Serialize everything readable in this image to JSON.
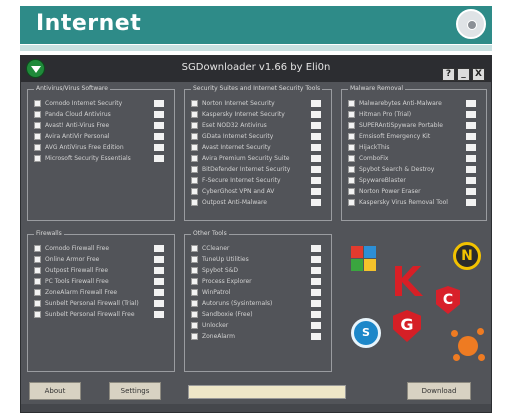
{
  "banner": {
    "title": "Internet",
    "accent": "#2e8b88"
  },
  "window": {
    "title": "SGDownloader v1.66 by Eli0n",
    "controls": [
      "?",
      "_",
      "X"
    ]
  },
  "panels": [
    {
      "title": "Antivirus/Virus Software",
      "items": [
        {
          "label": "Comodo Internet Security",
          "version": ""
        },
        {
          "label": "Panda Cloud Antivirus",
          "version": ""
        },
        {
          "label": "Avast! Anti-Virus Free",
          "version": ""
        },
        {
          "label": "Avira AntiVir Personal",
          "version": ""
        },
        {
          "label": "AVG AntiVirus Free Edition",
          "version": ""
        },
        {
          "label": "Microsoft Security Essentials",
          "version": ""
        }
      ]
    },
    {
      "title": "Security Suites and Internet Security Tools",
      "items": [
        {
          "label": "Norton Internet Security",
          "version": ""
        },
        {
          "label": "Kaspersky Internet Security",
          "version": ""
        },
        {
          "label": "Eset NOD32 Antivirus",
          "version": ""
        },
        {
          "label": "GData Internet Security",
          "version": ""
        },
        {
          "label": "Avast Internet Security",
          "version": ""
        },
        {
          "label": "Avira Premium Security Suite",
          "version": ""
        },
        {
          "label": "BitDefender Internet Security",
          "version": ""
        },
        {
          "label": "F-Secure Internet Security",
          "version": ""
        },
        {
          "label": "CyberGhost VPN and AV",
          "version": ""
        },
        {
          "label": "Outpost Anti-Malware",
          "version": ""
        }
      ]
    },
    {
      "title": "Malware Removal",
      "items": [
        {
          "label": "Malwarebytes Anti-Malware",
          "version": ""
        },
        {
          "label": "Hitman Pro (Trial)",
          "version": ""
        },
        {
          "label": "SUPERAntiSpyware Portable",
          "version": ""
        },
        {
          "label": "Emsisoft Emergency Kit",
          "version": ""
        },
        {
          "label": "HijackThis",
          "version": ""
        },
        {
          "label": "ComboFix",
          "version": ""
        },
        {
          "label": "Spybot Search & Destroy",
          "version": ""
        },
        {
          "label": "SpywareBlaster",
          "version": ""
        },
        {
          "label": "Norton Power Eraser",
          "version": ""
        },
        {
          "label": "Kaspersky Virus Removal Tool",
          "version": ""
        }
      ]
    },
    {
      "title": "Firewalls",
      "items": [
        {
          "label": "Comodo Firewall Free",
          "version": ""
        },
        {
          "label": "Online Armor Free",
          "version": ""
        },
        {
          "label": "Outpost Firewall Free",
          "version": ""
        },
        {
          "label": "PC Tools Firewall Free",
          "version": ""
        },
        {
          "label": "ZoneAlarm Firewall Free",
          "version": ""
        },
        {
          "label": "Sunbelt Personal Firewall (Trial)",
          "version": ""
        },
        {
          "label": "Sunbelt Personal Firewall Free",
          "version": ""
        }
      ]
    },
    {
      "title": "Other Tools",
      "items": [
        {
          "label": "CCleaner",
          "version": ""
        },
        {
          "label": "TuneUp Utilities",
          "version": ""
        },
        {
          "label": "Spybot S&D",
          "version": ""
        },
        {
          "label": "Process Explorer",
          "version": ""
        },
        {
          "label": "WinPatrol",
          "version": ""
        },
        {
          "label": "Autoruns (Sysinternals)",
          "version": ""
        },
        {
          "label": "Sandboxie (Free)",
          "version": ""
        },
        {
          "label": "Unlocker",
          "version": ""
        },
        {
          "label": "ZoneAlarm",
          "version": ""
        }
      ]
    }
  ],
  "logos": [
    "shield-logo",
    "kaspersky-k-logo",
    "norton-n-logo",
    "comodo-c-logo",
    "gdata-g-logo",
    "security-s-logo",
    "avast-logo"
  ],
  "buttons": {
    "about": "About",
    "settings": "Settings",
    "download": "Download"
  },
  "progress": {
    "value": 0
  }
}
